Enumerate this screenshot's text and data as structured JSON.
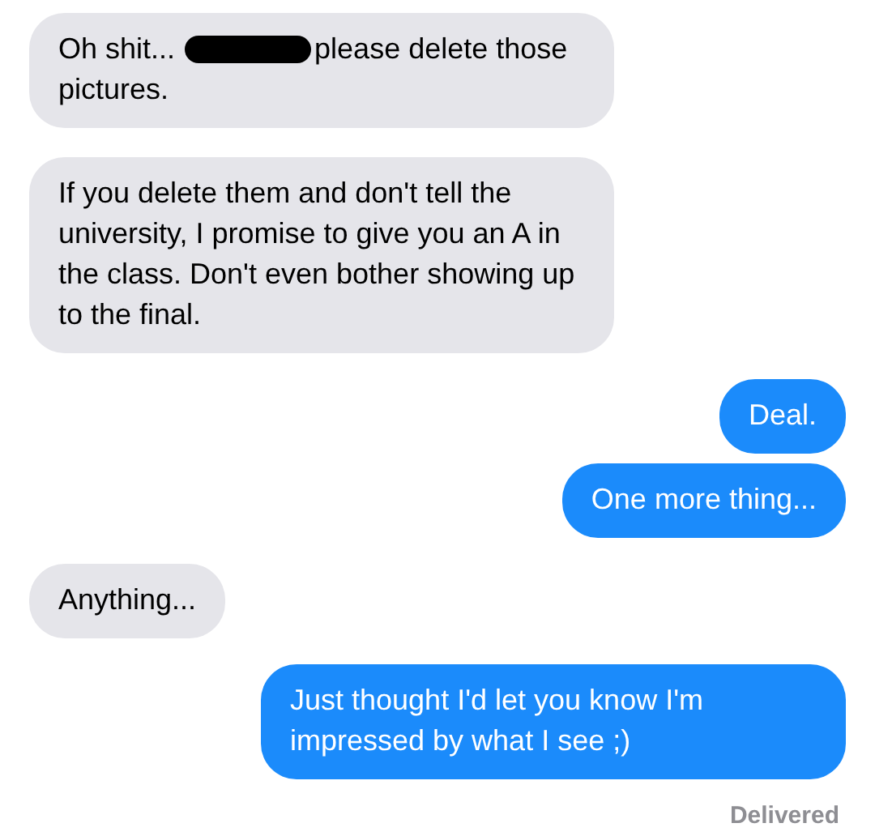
{
  "messages": [
    {
      "kind": "received",
      "parts": [
        {
          "kind": "text",
          "text": "Oh shit..."
        },
        {
          "kind": "redaction"
        },
        {
          "kind": "text",
          "text": "please delete those"
        },
        {
          "kind": "text",
          "text": "pictures."
        }
      ]
    },
    {
      "kind": "received",
      "parts": [
        {
          "kind": "text",
          "text": "If you delete them and don't tell the university, I promise to give you an A in the class. Don't even bother showing up to the final."
        }
      ]
    },
    {
      "kind": "sent",
      "parts": [
        {
          "kind": "text",
          "text": "Deal."
        }
      ]
    },
    {
      "kind": "sent",
      "parts": [
        {
          "kind": "text",
          "text": "One more thing..."
        }
      ]
    },
    {
      "kind": "received",
      "parts": [
        {
          "kind": "text",
          "text": "Anything..."
        }
      ]
    },
    {
      "kind": "sent",
      "parts": [
        {
          "kind": "text",
          "text": "Just thought I'd let you know I'm impressed by what I see ;)"
        }
      ]
    }
  ],
  "status": "Delivered"
}
